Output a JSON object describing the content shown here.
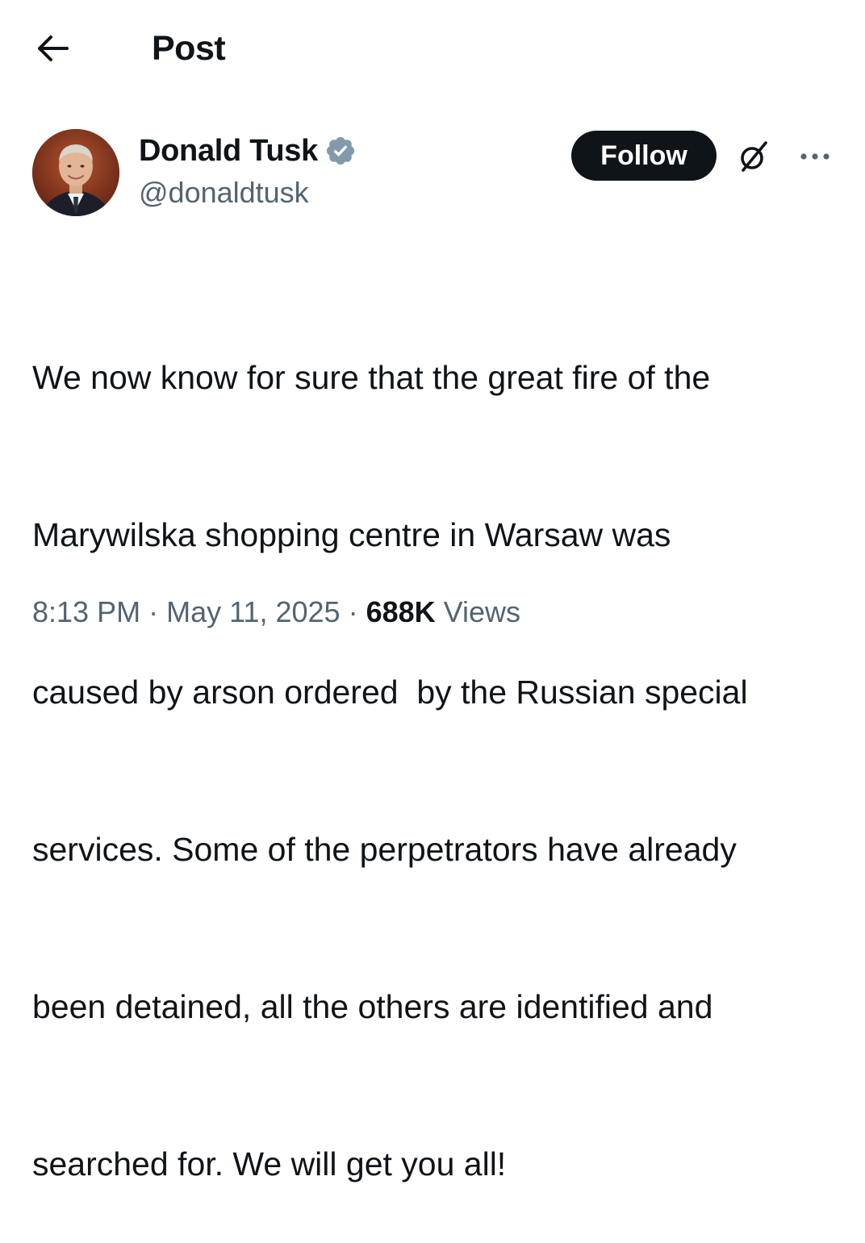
{
  "header": {
    "title": "Post",
    "back_icon": "arrow-left-icon"
  },
  "author": {
    "display_name": "Donald Tusk",
    "handle": "@donaldtusk",
    "verified_icon": "verified-badge-icon",
    "verified_color": "#829aab",
    "avatar_icon": "avatar-photo"
  },
  "actions": {
    "follow_label": "Follow",
    "grok_icon": "grok-icon",
    "more_icon": "more-dots-icon"
  },
  "post": {
    "lines": [
      "We now know for sure that the great fire of the",
      "Marywilska shopping centre in Warsaw was",
      "caused by arson ordered  by the Russian special",
      "services. Some of the perpetrators have already",
      "been detained, all the others are identified and",
      "searched for. We will get you all!"
    ]
  },
  "meta": {
    "time": "8:13 PM",
    "separator": " · ",
    "date": "May 11, 2025",
    "views_count": "688K",
    "views_label": " Views"
  },
  "colors": {
    "text_primary": "#0f1419",
    "text_secondary": "#536471",
    "follow_bg": "#0f1419"
  }
}
